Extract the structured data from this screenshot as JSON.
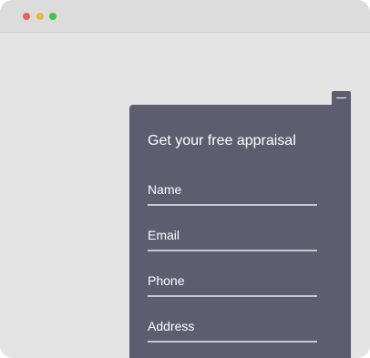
{
  "window": {
    "controls": {
      "close_color": "#ed5f57",
      "minimize_color": "#ecb63a",
      "maximize_color": "#3bc547"
    }
  },
  "widget": {
    "minimize_icon": "minus-icon",
    "title": "Get your free appraisal",
    "fields": [
      {
        "label": "Name"
      },
      {
        "label": "Email"
      },
      {
        "label": "Phone"
      },
      {
        "label": "Address"
      }
    ]
  }
}
